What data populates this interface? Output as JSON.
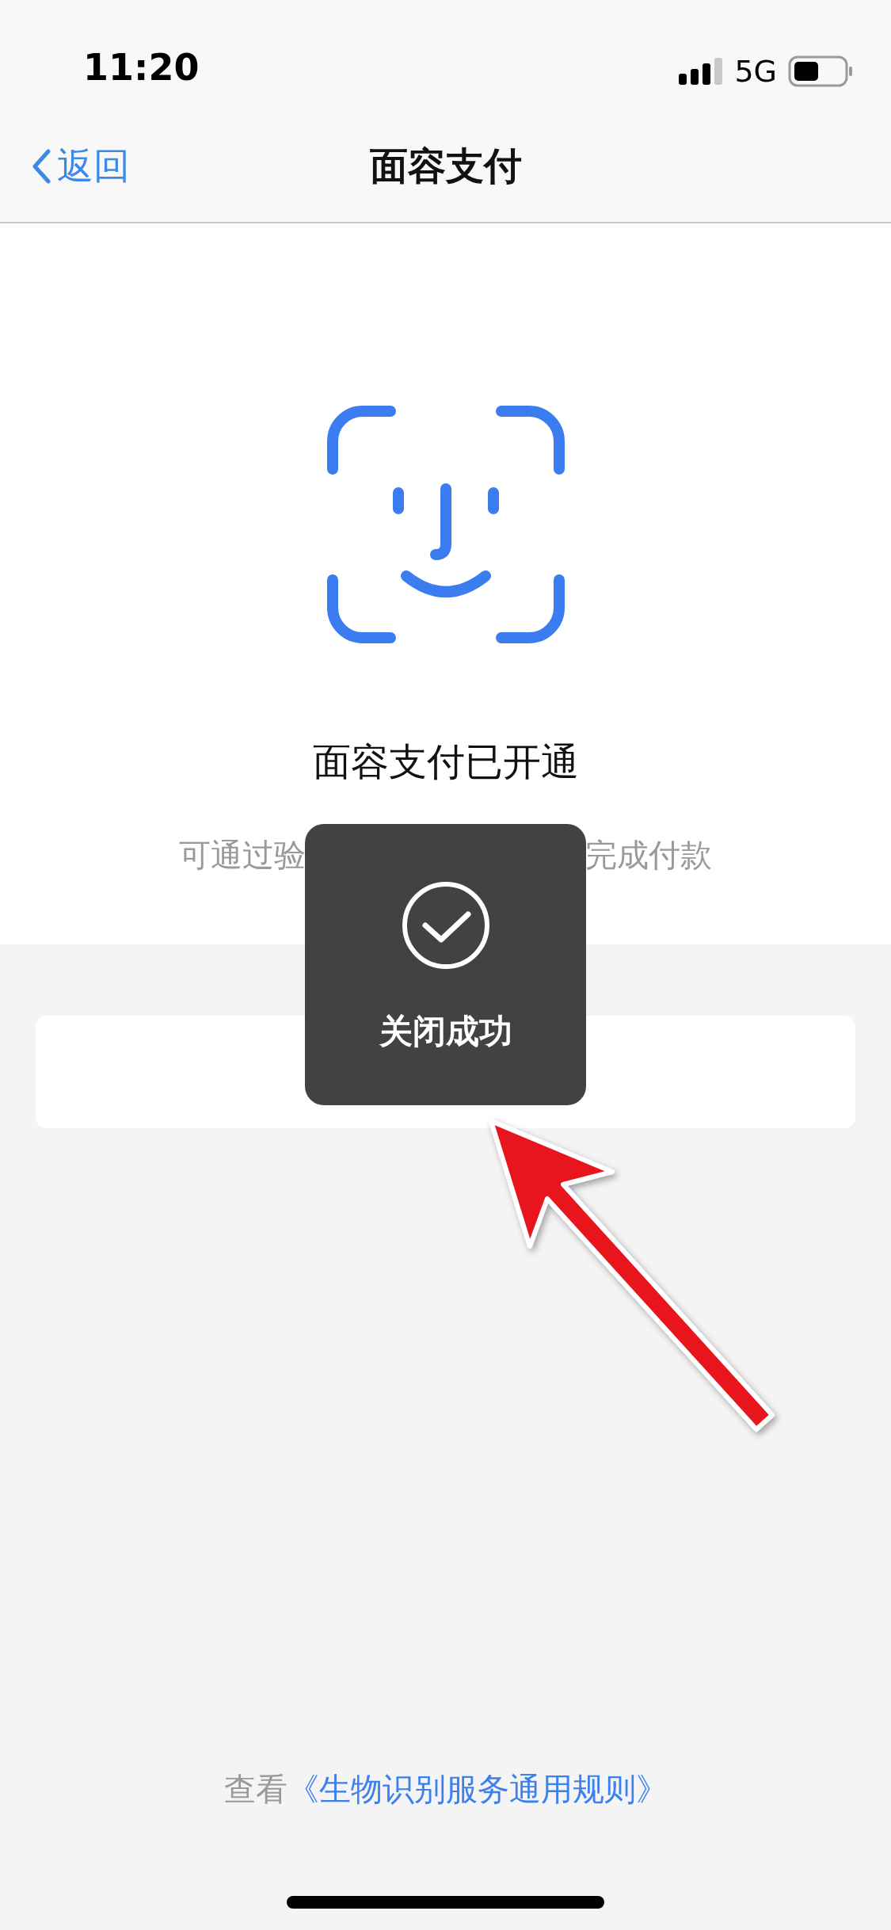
{
  "status_bar": {
    "time": "11:20",
    "network": "5G"
  },
  "nav": {
    "back": "返回",
    "title": "面容支付"
  },
  "status": {
    "title": "面容支付已开通",
    "subtitle_parts": [
      "可通过验",
      "完成付款"
    ]
  },
  "toast": {
    "message": "关闭成功"
  },
  "footer": {
    "prefix": "查看",
    "link": "《生物识别服务通用规则》"
  }
}
